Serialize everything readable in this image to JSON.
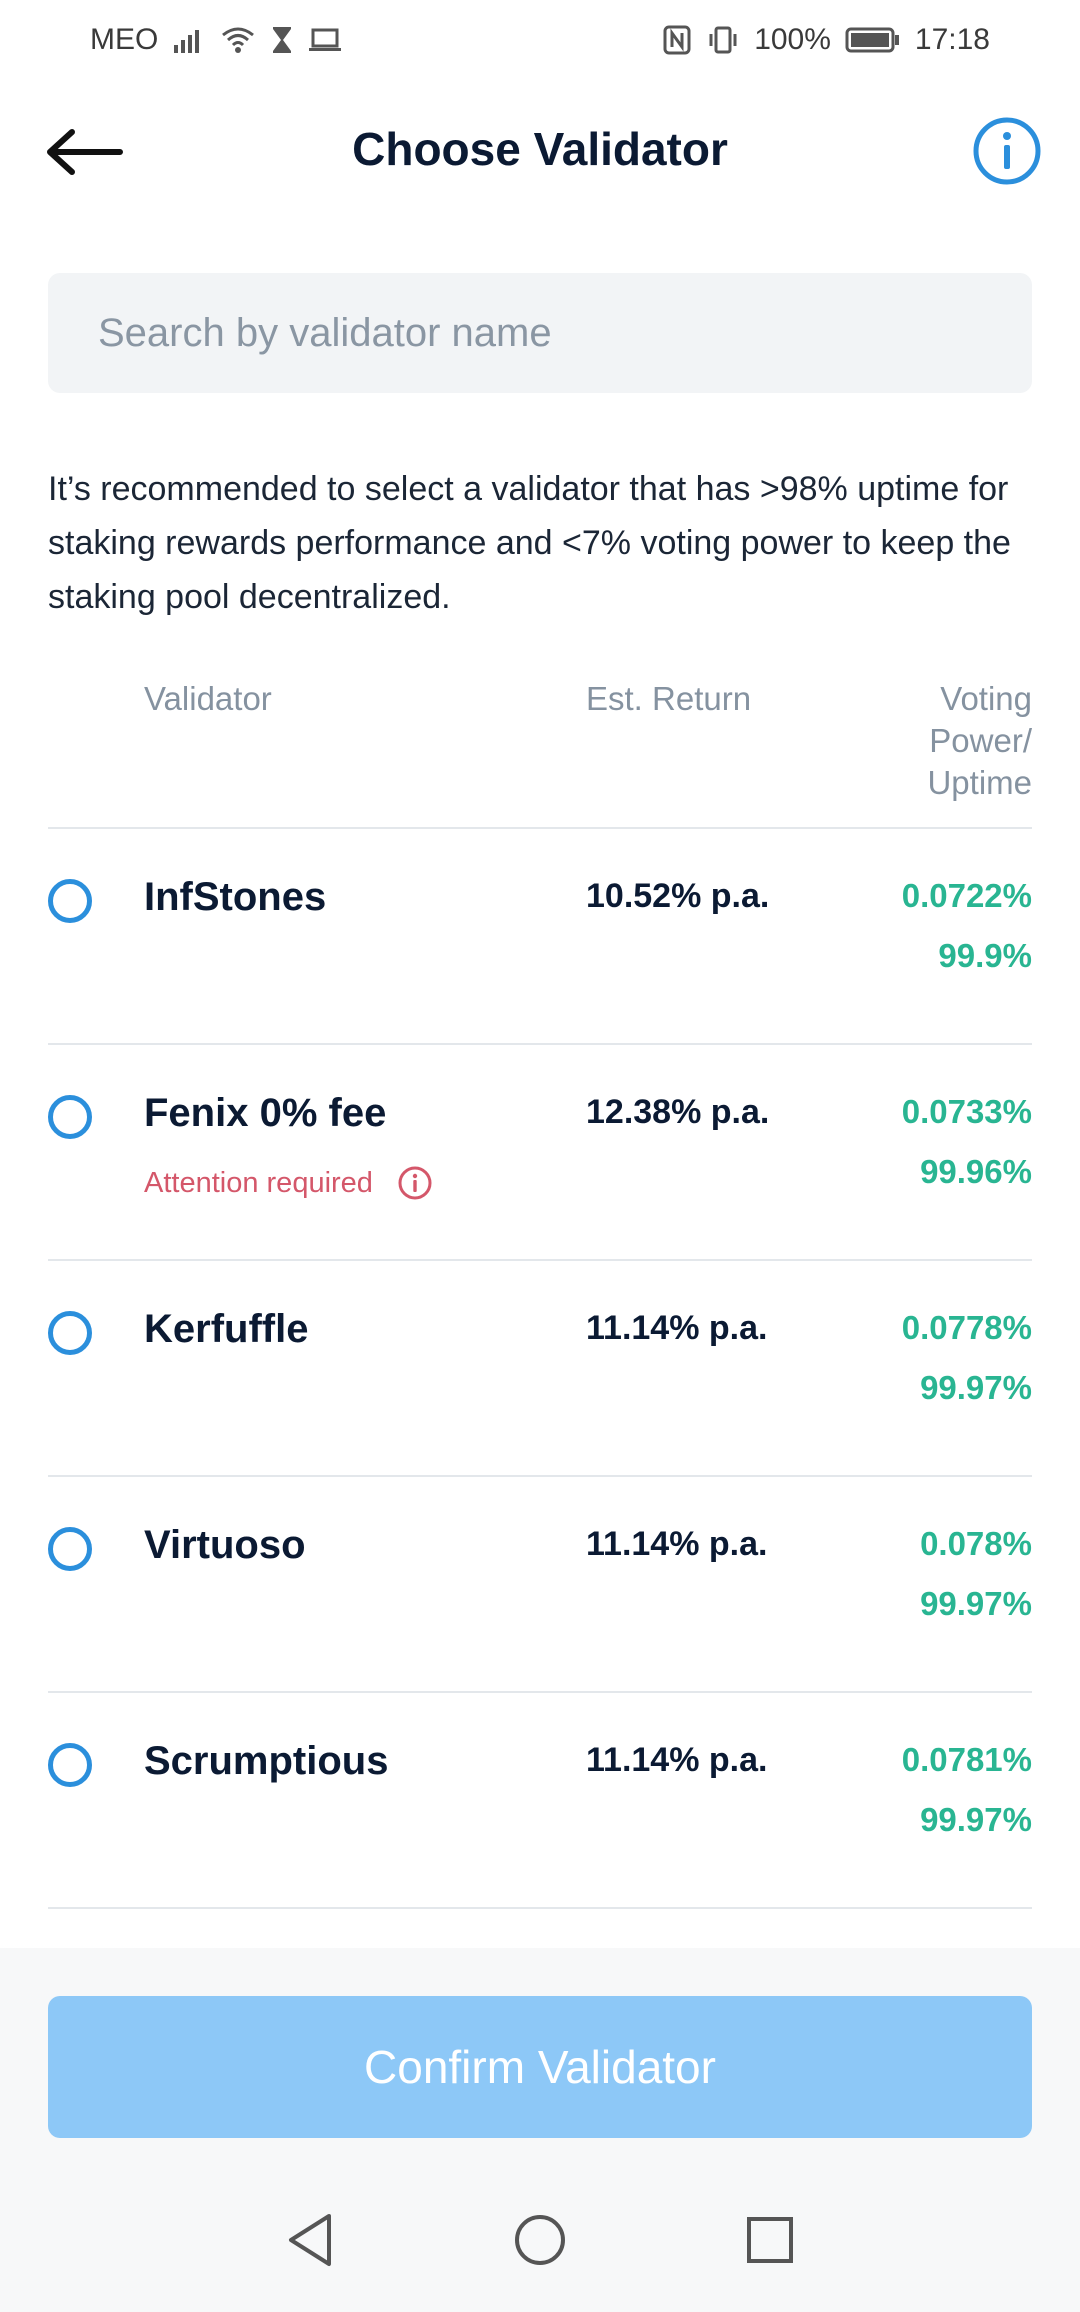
{
  "status_bar": {
    "carrier": "MEO",
    "battery": "100%",
    "time": "17:18"
  },
  "header": {
    "title": "Choose Validator"
  },
  "search": {
    "placeholder": "Search by validator name",
    "value": ""
  },
  "recommendation": "It’s recommended to select a validator that has >98% uptime for staking rewards performance and <7% voting power to keep the staking pool decentralized.",
  "table": {
    "col_validator": "Validator",
    "col_return": "Est. Return",
    "col_voting_line1": "Voting",
    "col_voting_line2": "Power/",
    "col_voting_line3": "Uptime"
  },
  "validators": [
    {
      "name": "InfStones",
      "return": "10.52% p.a.",
      "voting_power": "0.0722%",
      "uptime": "99.9%",
      "attention": ""
    },
    {
      "name": "Fenix 0% fee",
      "return": "12.38% p.a.",
      "voting_power": "0.0733%",
      "uptime": "99.96%",
      "attention": "Attention required"
    },
    {
      "name": "Kerfuffle",
      "return": "11.14% p.a.",
      "voting_power": "0.0778%",
      "uptime": "99.97%",
      "attention": ""
    },
    {
      "name": "Virtuoso",
      "return": "11.14% p.a.",
      "voting_power": "0.078%",
      "uptime": "99.97%",
      "attention": ""
    },
    {
      "name": "Scrumptious",
      "return": "11.14% p.a.",
      "voting_power": "0.0781%",
      "uptime": "99.97%",
      "attention": ""
    }
  ],
  "footer": {
    "confirm_label": "Confirm Validator"
  },
  "colors": {
    "accent": "#2b8fdc",
    "positive": "#29b592",
    "warning": "#d4576a",
    "confirm_disabled": "#8dc8f7"
  },
  "icons": {
    "back": "arrow-left-icon",
    "info": "info-circle-icon",
    "radio": "radio-unchecked-icon",
    "attention": "info-circle-icon",
    "nav_back": "triangle-back-icon",
    "nav_home": "circle-home-icon",
    "nav_recent": "square-recent-icon"
  }
}
